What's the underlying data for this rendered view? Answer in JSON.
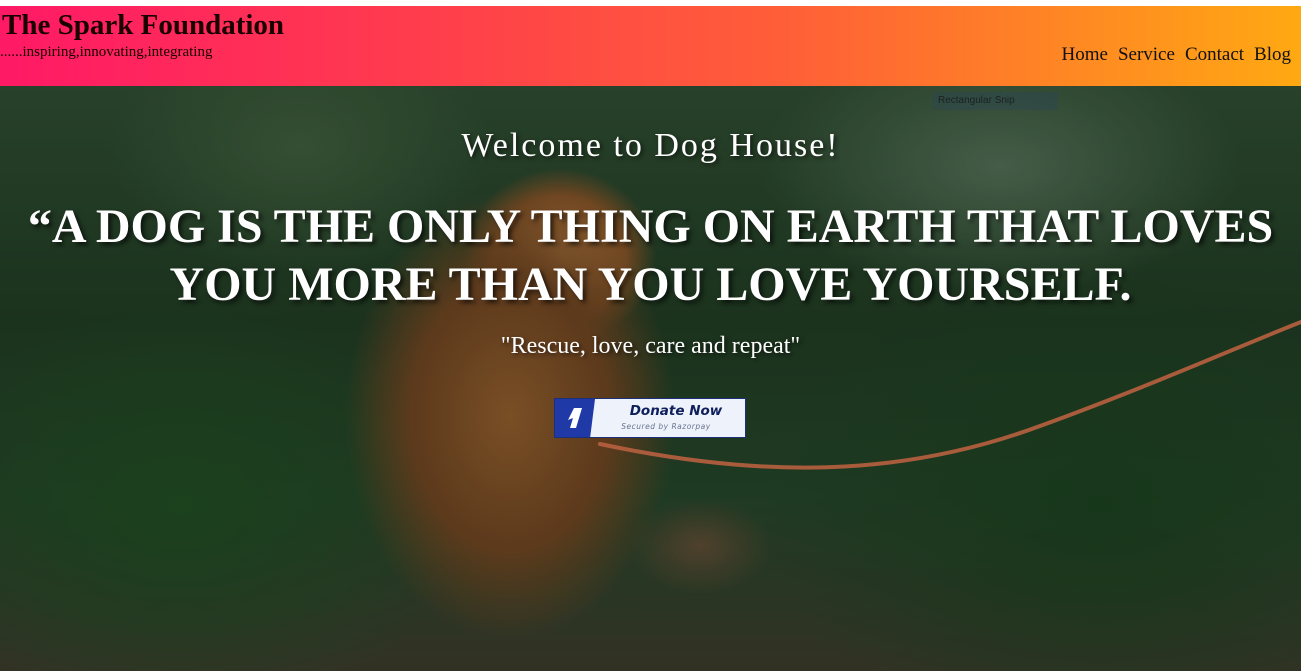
{
  "header": {
    "title": "The Spark Foundation",
    "tagline": "......inspiring,innovating,integrating",
    "nav": [
      {
        "label": "Home"
      },
      {
        "label": "Service"
      },
      {
        "label": "Contact"
      },
      {
        "label": "Blog"
      }
    ],
    "gradient_colors": [
      "#ff1966",
      "#ffa912"
    ]
  },
  "hero": {
    "snip_label": "Rectangular Snip",
    "welcome": "Welcome to Dog House!",
    "quote": "“A DOG IS THE ONLY THING ON EARTH THAT LOVES YOU MORE THAN YOU LOVE YOURSELF.",
    "motto": "\"Rescue, love, care and repeat\"",
    "background_description_icon": "dog-photo",
    "donate": {
      "label": "Donate Now",
      "sub_label": "Secured by Razorpay",
      "icon": "razorpay-icon",
      "brand_color": "#1f3aa6"
    }
  }
}
